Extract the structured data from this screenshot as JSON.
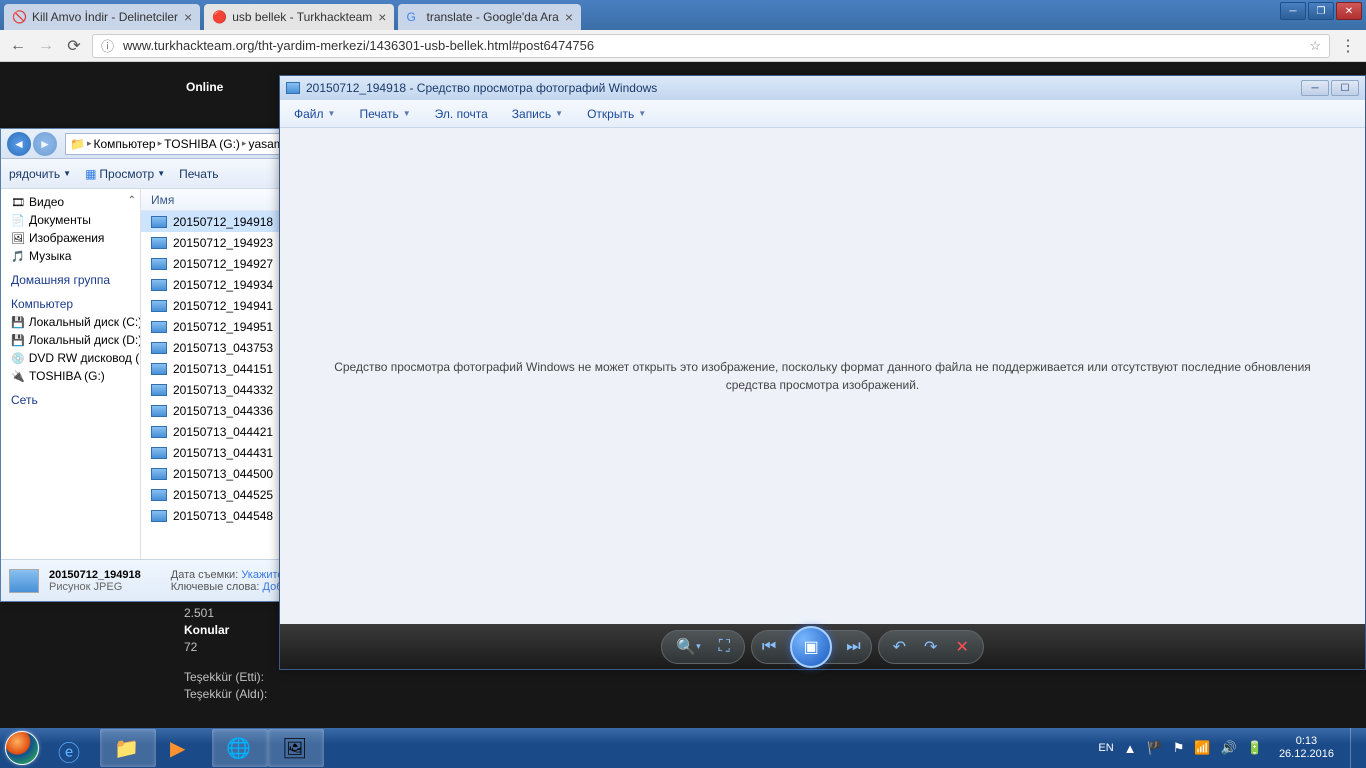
{
  "window_controls": {
    "minimize": "─",
    "maximize": "❐",
    "close": "✕"
  },
  "chrome": {
    "tabs": [
      {
        "title": "Kill Amvo İndir - Delinetciler",
        "active": false
      },
      {
        "title": "usb bellek - Turkhackteam",
        "active": true
      },
      {
        "title": "translate - Google'da Ara",
        "active": false
      }
    ],
    "url": "www.turkhackteam.org/tht-yardim-merkezi/1436301-usb-bellek.html#post6474756"
  },
  "forum": {
    "online": "Online",
    "stat_num": "2.501",
    "konular_label": "Konular",
    "konular_val": "72",
    "tesekkur1": "Teşekkür (Etti):",
    "tesekkur2": "Teşekkür (Aldı):"
  },
  "explorer": {
    "breadcrumb": {
      "computer": "Компьютер",
      "drive": "TOSHIBA (G:)",
      "folder": "yasam"
    },
    "toolbar": {
      "organize": "рядочить",
      "view": "Просмотр",
      "print": "Печать"
    },
    "sidebar": {
      "video": "Видео",
      "documents": "Документы",
      "images": "Изображения",
      "music": "Музыка",
      "homegroup": "Домашняя группа",
      "computer": "Компьютер",
      "disk_c": "Локальный диск (C:)",
      "disk_d": "Локальный диск (D:)",
      "dvd": "DVD RW дисковод (E:)",
      "toshiba": "TOSHIBA (G:)",
      "network": "Сеть"
    },
    "col_name": "Имя",
    "files": [
      "20150712_194918",
      "20150712_194923",
      "20150712_194927",
      "20150712_194934",
      "20150712_194941",
      "20150712_194951",
      "20150713_043753",
      "20150713_044151",
      "20150713_044332",
      "20150713_044336",
      "20150713_044421",
      "20150713_044431",
      "20150713_044500",
      "20150713_044525",
      "20150713_044548"
    ],
    "status": {
      "name": "20150712_194918",
      "type": "Рисунок JPEG",
      "date_label": "Дата съемки:",
      "date_val": "Укажите",
      "keywords_label": "Ключевые слова:",
      "keywords_val": "Добавьте"
    }
  },
  "viewer": {
    "title": "20150712_194918 - Средство просмотра фотографий Windows",
    "menu": {
      "file": "Файл",
      "print": "Печать",
      "email": "Эл. почта",
      "burn": "Запись",
      "open": "Открыть"
    },
    "error": "Средство просмотра фотографий Windows не может открыть это изображение, поскольку формат данного файла не поддерживается или отсутствуют последние обновления средства просмотра изображений."
  },
  "taskbar": {
    "lang": "EN",
    "time": "0:13",
    "date": "26.12.2016"
  }
}
